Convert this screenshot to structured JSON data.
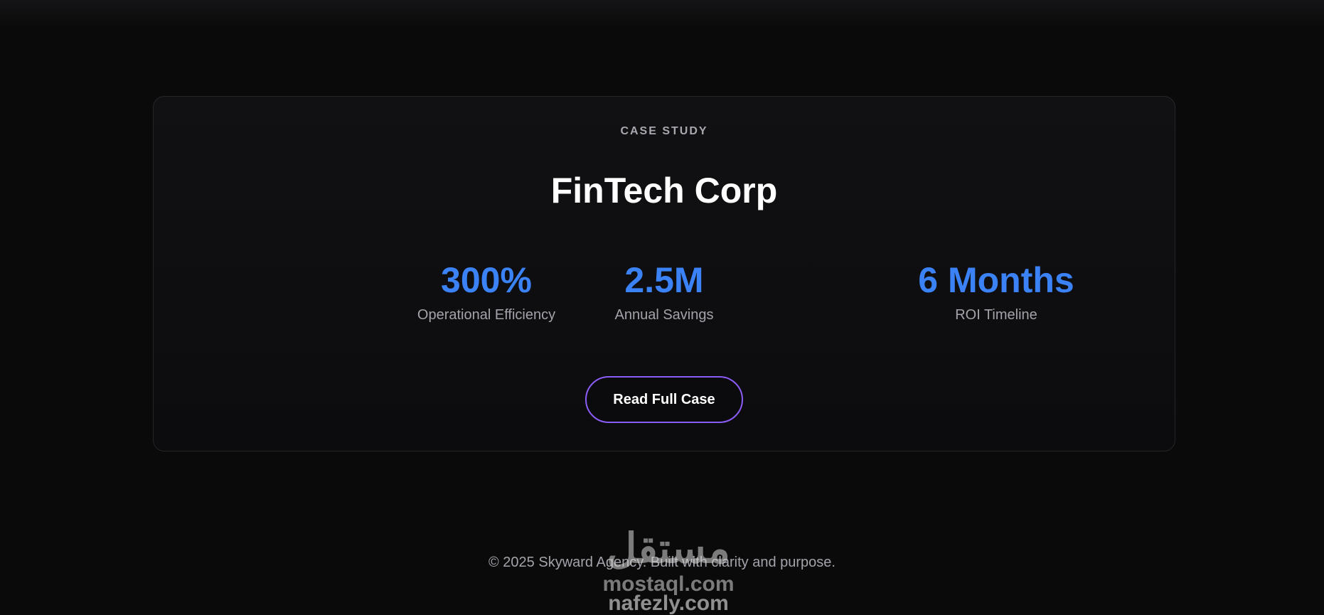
{
  "case_study": {
    "eyebrow": "CASE STUDY",
    "title": "FinTech Corp",
    "stats": [
      {
        "value": "300%",
        "label": "Operational Efficiency"
      },
      {
        "value": "2.5M",
        "label": "Annual Savings"
      },
      {
        "value": "6 Months",
        "label": "ROI Timeline"
      }
    ],
    "cta_label": "Read Full Case"
  },
  "footer": {
    "text": "© 2025 Skyward Agency. Built with clarity and purpose."
  },
  "watermark": {
    "arabic": "مستقل",
    "line1": "mostaql.com",
    "line2": "nafezly.com"
  },
  "colors": {
    "accent": "#3b82f6",
    "button_border": "#8b5cf6",
    "background": "#0a0a0b"
  }
}
